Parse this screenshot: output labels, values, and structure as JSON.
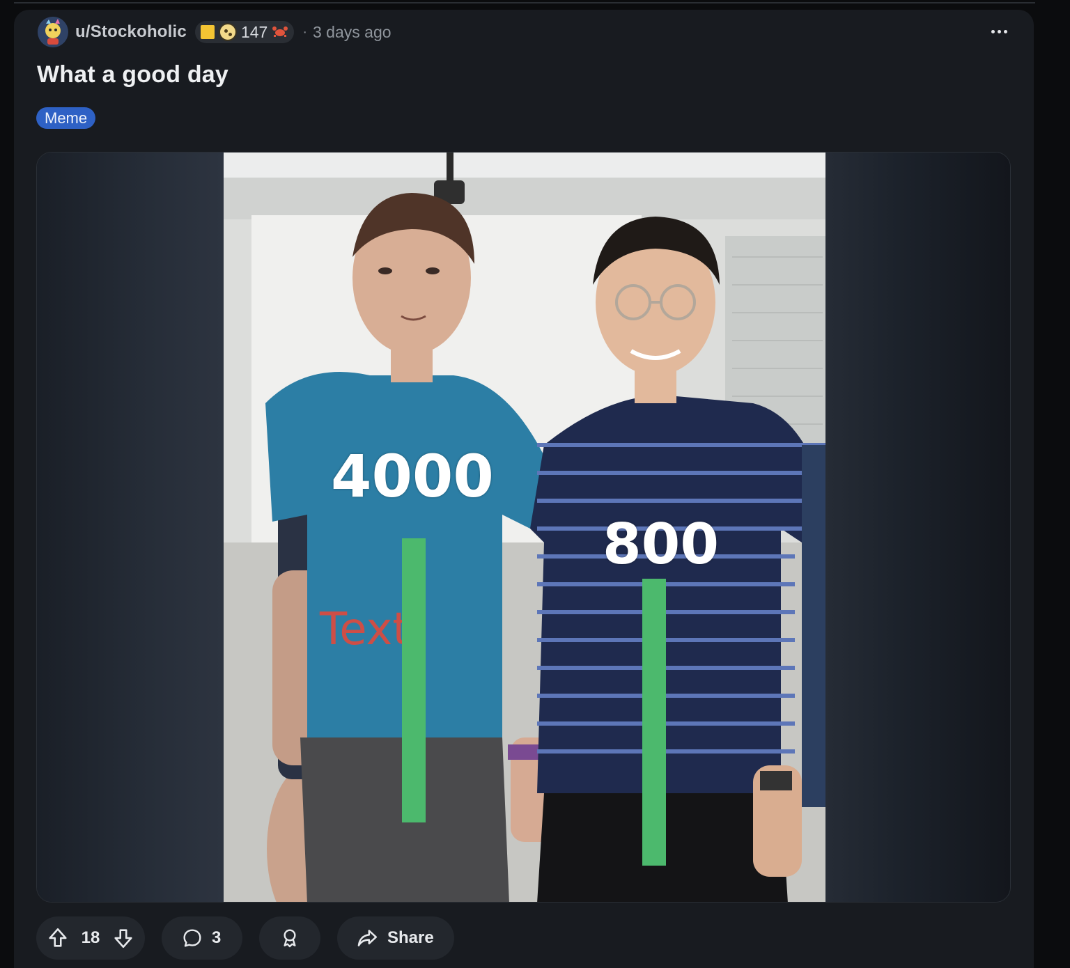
{
  "post": {
    "author": "u/Stockoholic",
    "flair_count": "147",
    "separator": "·",
    "timestamp": "3 days ago",
    "title": "What a good day",
    "tag": "Meme"
  },
  "meme": {
    "left_label": "4000",
    "right_label": "800",
    "shirt_text": "Text"
  },
  "actions": {
    "score": "18",
    "comments": "3",
    "share": "Share"
  },
  "colors": {
    "tag_bg": "#2e61c5",
    "bar_green": "#4cb96d",
    "card_bg": "#181b20"
  }
}
